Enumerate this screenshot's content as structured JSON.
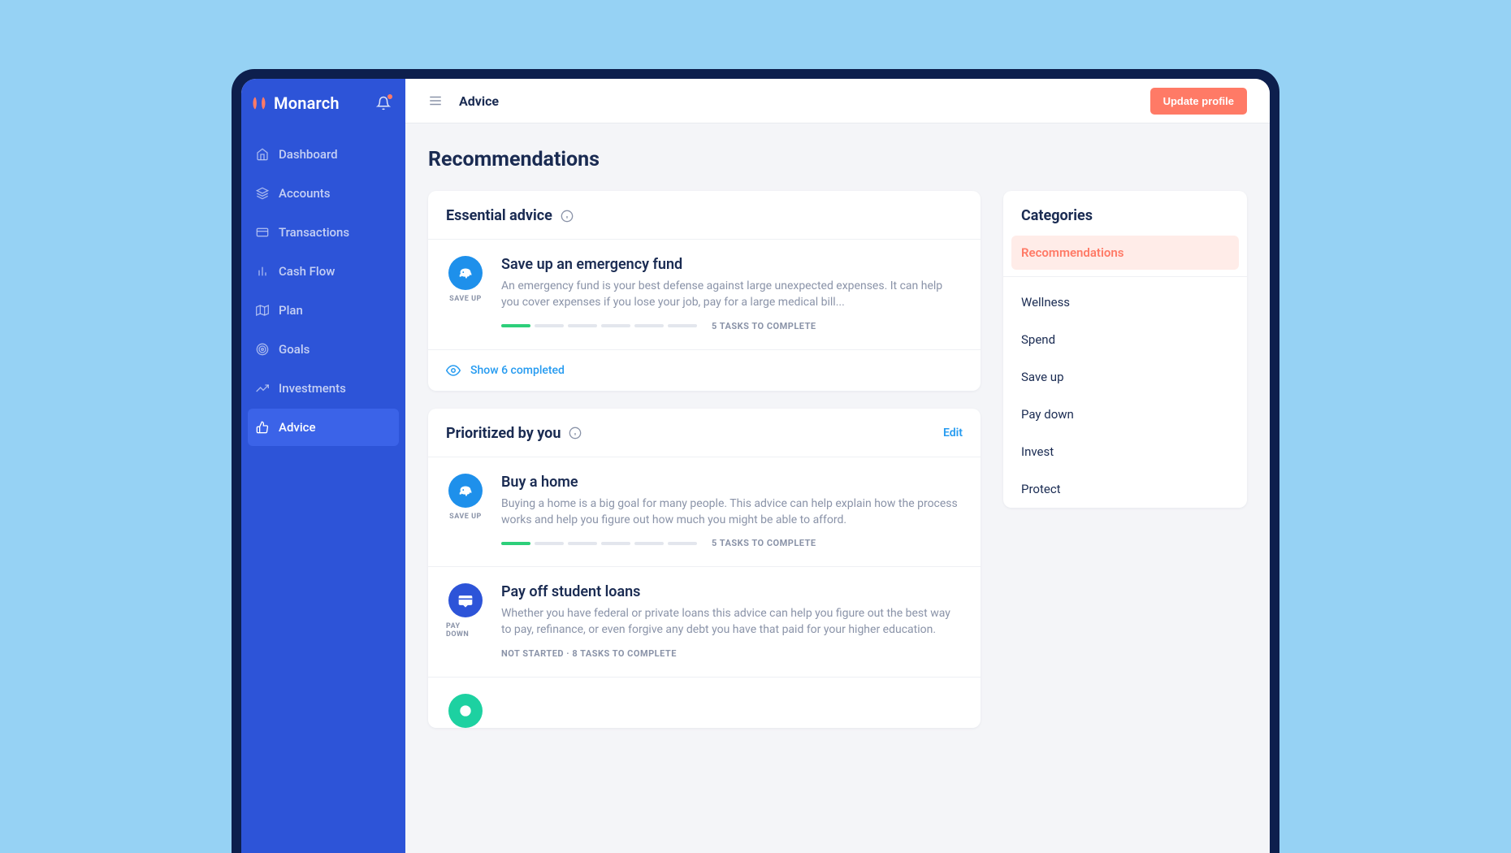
{
  "brand": {
    "name": "Monarch"
  },
  "nav": {
    "items": [
      {
        "label": "Dashboard",
        "icon": "dashboard-icon"
      },
      {
        "label": "Accounts",
        "icon": "accounts-icon"
      },
      {
        "label": "Transactions",
        "icon": "transactions-icon"
      },
      {
        "label": "Cash Flow",
        "icon": "cashflow-icon"
      },
      {
        "label": "Plan",
        "icon": "plan-icon"
      },
      {
        "label": "Goals",
        "icon": "goals-icon"
      },
      {
        "label": "Investments",
        "icon": "investments-icon"
      },
      {
        "label": "Advice",
        "icon": "advice-icon"
      }
    ],
    "active_index": 7
  },
  "topbar": {
    "title": "Advice",
    "update_button": "Update profile"
  },
  "page": {
    "title": "Recommendations"
  },
  "essential": {
    "heading": "Essential advice",
    "items": [
      {
        "category": "SAVE UP",
        "title": "Save up an emergency fund",
        "desc": "An emergency fund is your best defense against large unexpected expenses. It can help you cover expenses if you lose your job, pay for a large medical bill...",
        "segments_total": 6,
        "segments_filled": 1,
        "tasks_label": "5 TASKS TO COMPLETE"
      }
    ],
    "show_completed": "Show 6 completed"
  },
  "prioritized": {
    "heading": "Prioritized by you",
    "edit": "Edit",
    "items": [
      {
        "category": "SAVE UP",
        "title": "Buy a home",
        "desc": "Buying a home is a big goal for many people. This advice can help explain how the process works and help you figure out how much you might be able to afford.",
        "segments_total": 6,
        "segments_filled": 1,
        "tasks_label": "5 TASKS TO COMPLETE"
      },
      {
        "category": "PAY DOWN",
        "title": "Pay off student loans",
        "desc": "Whether you have federal or private loans this advice can help you figure out the best way to pay, refinance, or even forgive any debt you have that paid for your higher education.",
        "status_line": "NOT STARTED  ·  8 TASKS TO COMPLETE"
      }
    ]
  },
  "categories": {
    "heading": "Categories",
    "items": [
      "Recommendations",
      "Wellness",
      "Spend",
      "Save up",
      "Pay down",
      "Invest",
      "Protect"
    ],
    "active_index": 0
  }
}
